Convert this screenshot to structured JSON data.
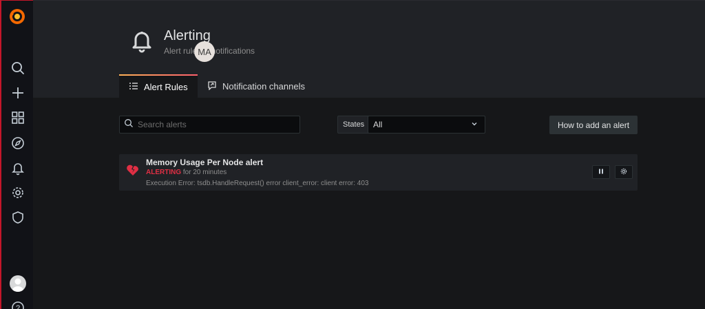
{
  "header": {
    "title": "Alerting",
    "subtitle": "Alert rules & notifications",
    "user_initials": "MA"
  },
  "tabs": [
    {
      "label": "Alert Rules",
      "icon": "list-icon",
      "active": true
    },
    {
      "label": "Notification channels",
      "icon": "comment-alt-share-icon",
      "active": false
    }
  ],
  "filters": {
    "search_placeholder": "Search alerts",
    "search_value": "",
    "states_label": "States",
    "states_selected": "All"
  },
  "actions": {
    "how_to_add_label": "How to add an alert"
  },
  "alerts": [
    {
      "name": "Memory Usage Per Node alert",
      "state": "ALERTING",
      "duration": " for 20 minutes",
      "error": "Execution Error: tsdb.HandleRequest() error client_error: client error: 403",
      "icon": "heart-break-icon"
    }
  ],
  "sidebar": {
    "items": [
      "search-icon",
      "plus-icon",
      "dashboards-icon",
      "explore-compass-icon",
      "bell-icon",
      "gear-icon",
      "shield-icon"
    ]
  },
  "colors": {
    "accent_red": "#e02f44",
    "tab_gradient_start": "#ffb357",
    "tab_gradient_end": "#ff5f6d"
  }
}
